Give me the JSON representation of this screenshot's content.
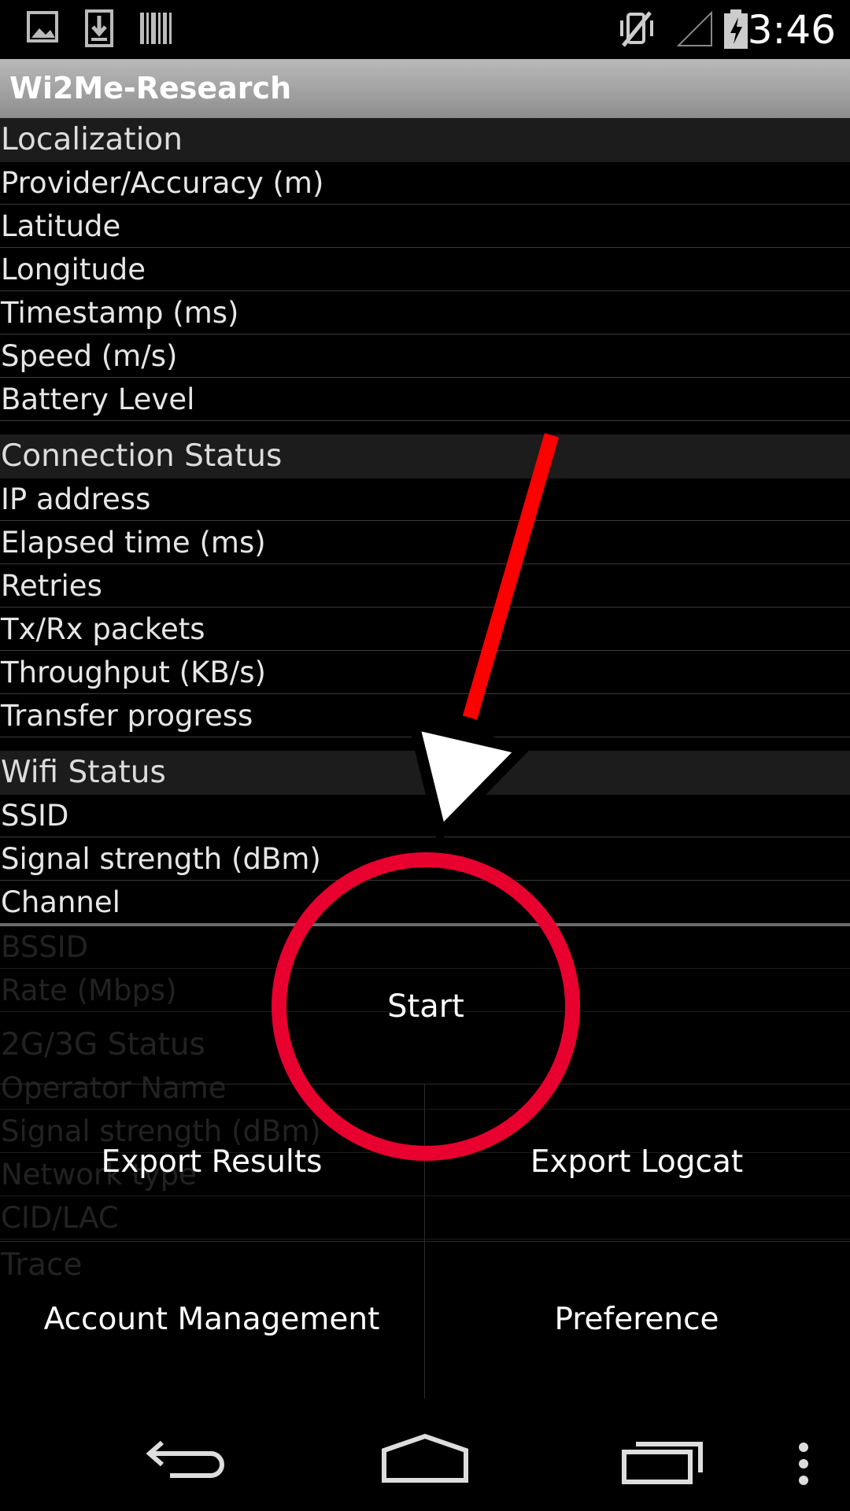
{
  "status_bar": {
    "time": "3:46",
    "left_icons": [
      "image-icon",
      "download-icon",
      "barcode-icon"
    ],
    "right_icons": [
      "vibrate-off-icon",
      "no-signal-icon",
      "battery-charging-icon"
    ]
  },
  "app": {
    "title": "Wi2Me-Research"
  },
  "sections": [
    {
      "header": "Localization",
      "rows": [
        "Provider/Accuracy (m)",
        "Latitude",
        "Longitude",
        "Timestamp (ms)",
        "Speed (m/s)",
        "Battery Level"
      ]
    },
    {
      "header": "Connection Status",
      "rows": [
        "IP address",
        "Elapsed time (ms)",
        "Retries",
        "Tx/Rx packets",
        "Throughput (KB/s)",
        "Transfer progress"
      ]
    },
    {
      "header": "Wifi Status",
      "rows": [
        "SSID",
        "Signal strength (dBm)",
        "Channel",
        "BSSID",
        "Rate (Mbps)"
      ]
    },
    {
      "header": "2G/3G Status",
      "rows": [
        "Operator Name",
        "Signal strength (dBm)",
        "Network type",
        "CID/LAC"
      ]
    },
    {
      "header": "Trace",
      "rows": []
    }
  ],
  "menu": {
    "start": "Start",
    "export_results": "Export Results",
    "export_logcat": "Export Logcat",
    "account_management": "Account Management",
    "preference": "Preference"
  },
  "overlay": {
    "arrow_color": "#ff0000",
    "circle_color": "#e8002e"
  },
  "nav_bar": {
    "icons": [
      "back-icon",
      "home-icon",
      "recents-icon",
      "overflow-menu-icon"
    ]
  }
}
